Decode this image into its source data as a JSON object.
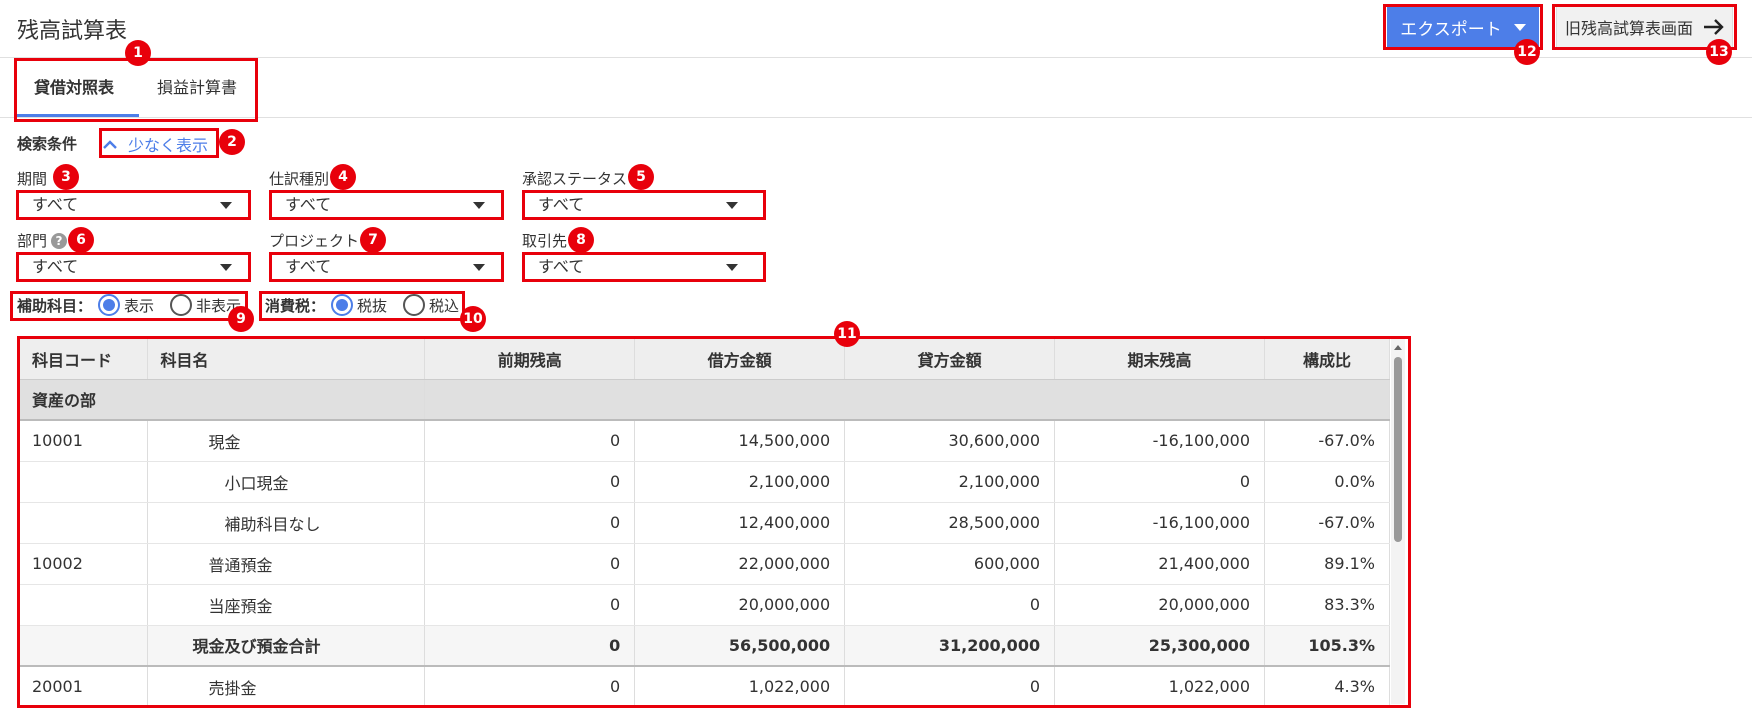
{
  "header": {
    "title": "残高試算表",
    "export_label": "エクスポート",
    "old_screen_label": "旧残高試算表画面"
  },
  "tabs": [
    {
      "label": "貸借対照表",
      "active": true
    },
    {
      "label": "損益計算書",
      "active": false
    }
  ],
  "search": {
    "label": "検索条件",
    "toggle_label": "少なく表示"
  },
  "filters": {
    "period": {
      "label": "期間",
      "value": "すべて"
    },
    "journal_type": {
      "label": "仕訳種別",
      "value": "すべて"
    },
    "approval_status": {
      "label": "承認ステータス",
      "value": "すべて"
    },
    "department": {
      "label": "部門",
      "value": "すべて"
    },
    "project": {
      "label": "プロジェクト",
      "value": "すべて"
    },
    "partner": {
      "label": "取引先",
      "value": "すべて"
    }
  },
  "sub_account": {
    "label": "補助科目：",
    "options": [
      "表示",
      "非表示"
    ],
    "selected": "表示"
  },
  "tax": {
    "label": "消費税：",
    "options": [
      "税抜",
      "税込"
    ],
    "selected": "税抜"
  },
  "table": {
    "columns": [
      "科目コード",
      "科目名",
      "前期残高",
      "借方金額",
      "貸方金額",
      "期末残高",
      "構成比"
    ],
    "section_label": "資産の部",
    "rows": [
      {
        "code": "10001",
        "name": "現金",
        "level": 1,
        "prev": "0",
        "debit": "14,500,000",
        "credit": "30,600,000",
        "end": "-16,100,000",
        "ratio": "-67.0%"
      },
      {
        "code": "",
        "name": "小口現金",
        "level": 2,
        "prev": "0",
        "debit": "2,100,000",
        "credit": "2,100,000",
        "end": "0",
        "ratio": "0.0%"
      },
      {
        "code": "",
        "name": "補助科目なし",
        "level": 2,
        "prev": "0",
        "debit": "12,400,000",
        "credit": "28,500,000",
        "end": "-16,100,000",
        "ratio": "-67.0%"
      },
      {
        "code": "10002",
        "name": "普通預金",
        "level": 1,
        "prev": "0",
        "debit": "22,000,000",
        "credit": "600,000",
        "end": "21,400,000",
        "ratio": "89.1%"
      },
      {
        "code": "",
        "name": "当座預金",
        "level": 1,
        "prev": "0",
        "debit": "20,000,000",
        "credit": "0",
        "end": "20,000,000",
        "ratio": "83.3%"
      },
      {
        "code": "",
        "name": "現金及び預金合計",
        "level": 0,
        "total": true,
        "prev": "0",
        "debit": "56,500,000",
        "credit": "31,200,000",
        "end": "25,300,000",
        "ratio": "105.3%"
      },
      {
        "code": "20001",
        "name": "売掛金",
        "level": 1,
        "prev": "0",
        "debit": "1,022,000",
        "credit": "0",
        "end": "1,022,000",
        "ratio": "4.3%"
      }
    ]
  },
  "badges": [
    "1",
    "2",
    "3",
    "4",
    "5",
    "6",
    "7",
    "8",
    "9",
    "10",
    "11",
    "12",
    "13"
  ],
  "colors": {
    "accent": "#4d7ee8",
    "annotation": "#e8000b"
  }
}
